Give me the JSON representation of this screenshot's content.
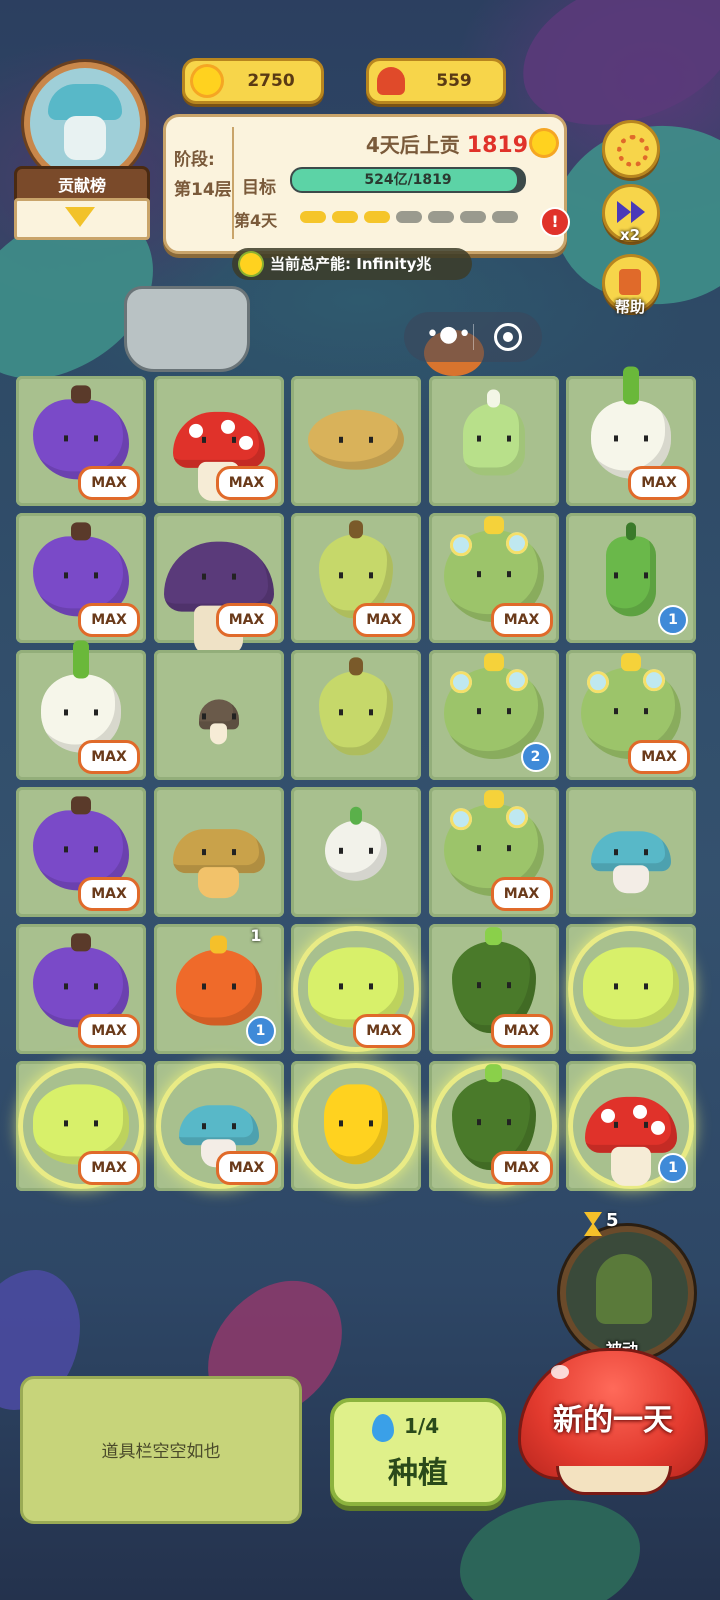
{
  "topbar": {
    "leaderboard_label": "贡献榜",
    "sun_value": "2750",
    "mushroom_value": "559"
  },
  "stage": {
    "label": "阶段:",
    "level": "第14层",
    "deadline_text": "4天后上贡",
    "deadline_value": "1819",
    "goal_label": "目标",
    "goal_progress_text": "524亿/1819",
    "goal_progress_fraction": 0.97,
    "day_label": "第4天",
    "days_total": 7,
    "days_done": 3,
    "alert_glyph": "!"
  },
  "production": {
    "label": "当前总产能:",
    "value": "Infinity兆"
  },
  "side_buttons": {
    "speed_label": "x2",
    "help_label": "帮助"
  },
  "grid": {
    "rows": [
      [
        {
          "plant": "eggplant",
          "badge": "MAX"
        },
        {
          "plant": "red-mushroom",
          "badge": "MAX"
        },
        {
          "plant": "potato",
          "badge": ""
        },
        {
          "plant": "bok-choy",
          "badge": ""
        },
        {
          "plant": "radish",
          "badge": "MAX"
        }
      ],
      [
        {
          "plant": "eggplant",
          "badge": "MAX"
        },
        {
          "plant": "purple-mushroom",
          "badge": "MAX"
        },
        {
          "plant": "pear",
          "badge": "MAX"
        },
        {
          "plant": "coconut",
          "badge": "MAX"
        },
        {
          "plant": "pepper",
          "badge": "1"
        }
      ],
      [
        {
          "plant": "radish",
          "badge": "MAX"
        },
        {
          "plant": "small-mushroom",
          "badge": ""
        },
        {
          "plant": "pear",
          "badge": ""
        },
        {
          "plant": "coconut",
          "badge": "2"
        },
        {
          "plant": "coconut",
          "badge": "MAX"
        }
      ],
      [
        {
          "plant": "eggplant",
          "badge": "MAX"
        },
        {
          "plant": "brown-mushroom",
          "badge": ""
        },
        {
          "plant": "turnip",
          "badge": ""
        },
        {
          "plant": "coconut",
          "badge": "MAX"
        },
        {
          "plant": "teal-mushroom",
          "badge": ""
        }
      ],
      [
        {
          "plant": "eggplant",
          "badge": "MAX"
        },
        {
          "plant": "onion",
          "badge": "1",
          "top_count": "1"
        },
        {
          "plant": "lettuce",
          "badge": "MAX"
        },
        {
          "plant": "avocado",
          "badge": "MAX"
        },
        {
          "plant": "lettuce",
          "badge": ""
        }
      ],
      [
        {
          "plant": "lettuce",
          "badge": "MAX"
        },
        {
          "plant": "teal-mushroom",
          "badge": "MAX"
        },
        {
          "plant": "golden-fruit",
          "badge": ""
        },
        {
          "plant": "avocado",
          "badge": "MAX"
        },
        {
          "plant": "red-mushroom",
          "badge": "1"
        }
      ]
    ]
  },
  "bottom": {
    "item_bar_text": "道具栏空空如也",
    "plant_count": "1/4",
    "plant_label": "种植",
    "new_day_label": "新的一天",
    "passive_label": "被动",
    "passive_count": "5"
  },
  "colors": {
    "accent_yellow": "#f7d54a",
    "deadline_red": "#e0322a",
    "progress_green": "#5cd3a6",
    "max_border": "#e06a2a",
    "count_blue": "#3f8ad8"
  }
}
